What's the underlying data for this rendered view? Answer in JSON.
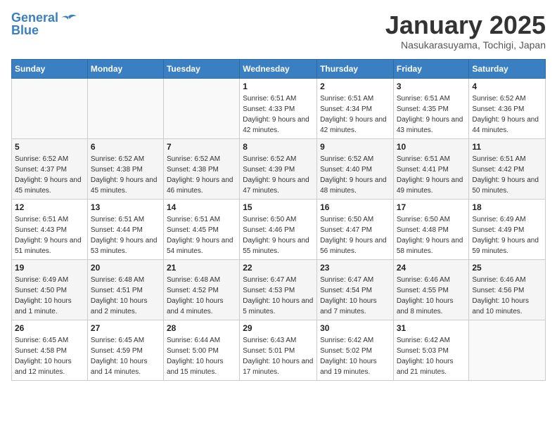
{
  "header": {
    "logo_line1": "General",
    "logo_line2": "Blue",
    "title": "January 2025",
    "subtitle": "Nasukarasuyama, Tochigi, Japan"
  },
  "weekdays": [
    "Sunday",
    "Monday",
    "Tuesday",
    "Wednesday",
    "Thursday",
    "Friday",
    "Saturday"
  ],
  "weeks": [
    [
      {
        "day": "",
        "info": ""
      },
      {
        "day": "",
        "info": ""
      },
      {
        "day": "",
        "info": ""
      },
      {
        "day": "1",
        "info": "Sunrise: 6:51 AM\nSunset: 4:33 PM\nDaylight: 9 hours and 42 minutes."
      },
      {
        "day": "2",
        "info": "Sunrise: 6:51 AM\nSunset: 4:34 PM\nDaylight: 9 hours and 42 minutes."
      },
      {
        "day": "3",
        "info": "Sunrise: 6:51 AM\nSunset: 4:35 PM\nDaylight: 9 hours and 43 minutes."
      },
      {
        "day": "4",
        "info": "Sunrise: 6:52 AM\nSunset: 4:36 PM\nDaylight: 9 hours and 44 minutes."
      }
    ],
    [
      {
        "day": "5",
        "info": "Sunrise: 6:52 AM\nSunset: 4:37 PM\nDaylight: 9 hours and 45 minutes."
      },
      {
        "day": "6",
        "info": "Sunrise: 6:52 AM\nSunset: 4:38 PM\nDaylight: 9 hours and 45 minutes."
      },
      {
        "day": "7",
        "info": "Sunrise: 6:52 AM\nSunset: 4:38 PM\nDaylight: 9 hours and 46 minutes."
      },
      {
        "day": "8",
        "info": "Sunrise: 6:52 AM\nSunset: 4:39 PM\nDaylight: 9 hours and 47 minutes."
      },
      {
        "day": "9",
        "info": "Sunrise: 6:52 AM\nSunset: 4:40 PM\nDaylight: 9 hours and 48 minutes."
      },
      {
        "day": "10",
        "info": "Sunrise: 6:51 AM\nSunset: 4:41 PM\nDaylight: 9 hours and 49 minutes."
      },
      {
        "day": "11",
        "info": "Sunrise: 6:51 AM\nSunset: 4:42 PM\nDaylight: 9 hours and 50 minutes."
      }
    ],
    [
      {
        "day": "12",
        "info": "Sunrise: 6:51 AM\nSunset: 4:43 PM\nDaylight: 9 hours and 51 minutes."
      },
      {
        "day": "13",
        "info": "Sunrise: 6:51 AM\nSunset: 4:44 PM\nDaylight: 9 hours and 53 minutes."
      },
      {
        "day": "14",
        "info": "Sunrise: 6:51 AM\nSunset: 4:45 PM\nDaylight: 9 hours and 54 minutes."
      },
      {
        "day": "15",
        "info": "Sunrise: 6:50 AM\nSunset: 4:46 PM\nDaylight: 9 hours and 55 minutes."
      },
      {
        "day": "16",
        "info": "Sunrise: 6:50 AM\nSunset: 4:47 PM\nDaylight: 9 hours and 56 minutes."
      },
      {
        "day": "17",
        "info": "Sunrise: 6:50 AM\nSunset: 4:48 PM\nDaylight: 9 hours and 58 minutes."
      },
      {
        "day": "18",
        "info": "Sunrise: 6:49 AM\nSunset: 4:49 PM\nDaylight: 9 hours and 59 minutes."
      }
    ],
    [
      {
        "day": "19",
        "info": "Sunrise: 6:49 AM\nSunset: 4:50 PM\nDaylight: 10 hours and 1 minute."
      },
      {
        "day": "20",
        "info": "Sunrise: 6:48 AM\nSunset: 4:51 PM\nDaylight: 10 hours and 2 minutes."
      },
      {
        "day": "21",
        "info": "Sunrise: 6:48 AM\nSunset: 4:52 PM\nDaylight: 10 hours and 4 minutes."
      },
      {
        "day": "22",
        "info": "Sunrise: 6:47 AM\nSunset: 4:53 PM\nDaylight: 10 hours and 5 minutes."
      },
      {
        "day": "23",
        "info": "Sunrise: 6:47 AM\nSunset: 4:54 PM\nDaylight: 10 hours and 7 minutes."
      },
      {
        "day": "24",
        "info": "Sunrise: 6:46 AM\nSunset: 4:55 PM\nDaylight: 10 hours and 8 minutes."
      },
      {
        "day": "25",
        "info": "Sunrise: 6:46 AM\nSunset: 4:56 PM\nDaylight: 10 hours and 10 minutes."
      }
    ],
    [
      {
        "day": "26",
        "info": "Sunrise: 6:45 AM\nSunset: 4:58 PM\nDaylight: 10 hours and 12 minutes."
      },
      {
        "day": "27",
        "info": "Sunrise: 6:45 AM\nSunset: 4:59 PM\nDaylight: 10 hours and 14 minutes."
      },
      {
        "day": "28",
        "info": "Sunrise: 6:44 AM\nSunset: 5:00 PM\nDaylight: 10 hours and 15 minutes."
      },
      {
        "day": "29",
        "info": "Sunrise: 6:43 AM\nSunset: 5:01 PM\nDaylight: 10 hours and 17 minutes."
      },
      {
        "day": "30",
        "info": "Sunrise: 6:42 AM\nSunset: 5:02 PM\nDaylight: 10 hours and 19 minutes."
      },
      {
        "day": "31",
        "info": "Sunrise: 6:42 AM\nSunset: 5:03 PM\nDaylight: 10 hours and 21 minutes."
      },
      {
        "day": "",
        "info": ""
      }
    ]
  ]
}
